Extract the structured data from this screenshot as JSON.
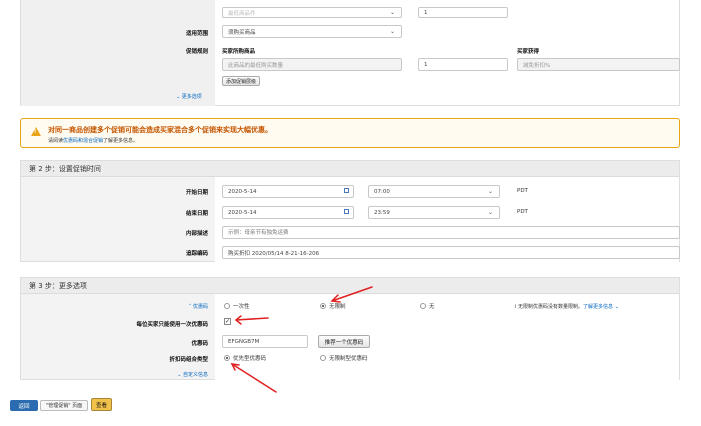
{
  "section1": {
    "row0": {
      "select_value": "最低商品件",
      "input_value": "1"
    },
    "applies_to": {
      "label": "适用范围",
      "select_value": "须购买商品"
    },
    "promo_rule": {
      "label": "促销规则",
      "col_buy": "买家所购商品",
      "col_get": "买家获得",
      "buy_placeholder": "此商品的最低购买数量",
      "qty_value": "1",
      "get_placeholder": "减免折扣%",
      "add_tier_button": "添加促销层级"
    },
    "more_options": "更多选项"
  },
  "warning": {
    "title": "对同一商品创建多个促销可能会造成买家混合多个促销来实现大幅优惠。",
    "sub_prefix": "请阅读",
    "sub_link": "优惠码和混合促销",
    "sub_suffix": "了解更多信息。"
  },
  "step2": {
    "title": "第 2 步：设置促销时间",
    "start": {
      "label": "开始日期",
      "date": "2020-5-14",
      "time": "07:00",
      "tz": "PDT"
    },
    "end": {
      "label": "结束日期",
      "date": "2020-5-14",
      "time": "23:59",
      "tz": "PDT"
    },
    "internal": {
      "label": "内部描述",
      "placeholder": "示例：母亲节有独免运费"
    },
    "tracking": {
      "label": "追踪编码",
      "value": "购买折扣 2020/05/14 8-21-16-206"
    }
  },
  "step3": {
    "title": "第 3 步：更多选项",
    "coupon": {
      "label": "优惠码",
      "options": [
        "一次性",
        "无限制",
        "无"
      ],
      "selected": 1,
      "note": "无限制优惠码没有数量限制。",
      "note_link": "了解更多信息"
    },
    "one_per_buyer": {
      "label": "每位买家只能使用一次优惠码"
    },
    "coupon_code": {
      "label": "优惠码",
      "value": "EFGNGB7M",
      "suggest_button": "推荐一个优惠码"
    },
    "combinable": {
      "label": "折扣码组合类型",
      "options": [
        "优先型优惠码",
        "无限制型优惠码"
      ],
      "selected": 0
    },
    "custom_message": "自定义信息"
  },
  "footer": {
    "back_button": "返回",
    "manage_label": "\"管理促销\" 页面",
    "review_button": "查看"
  },
  "colors": {
    "warning_border": "#e8a317",
    "warning_bg": "#fffbf0",
    "annotation_red": "#e02020",
    "link": "#0066c0",
    "back_button": "#2b6cb0",
    "review_button": "#f0c14b"
  }
}
